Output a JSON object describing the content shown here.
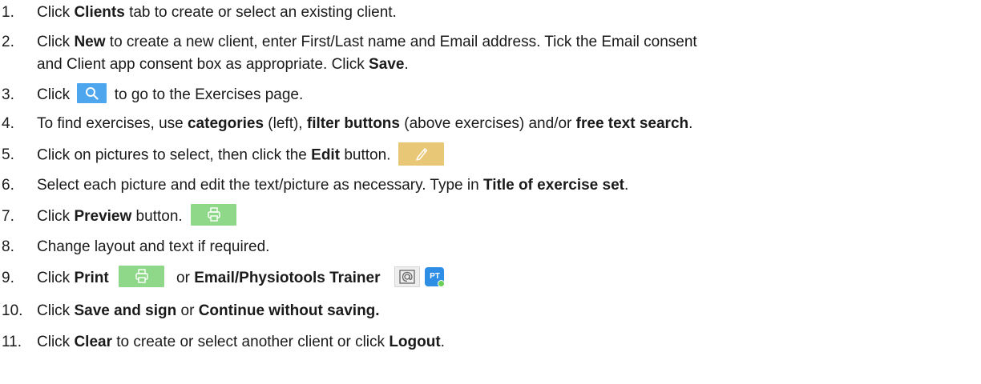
{
  "steps": [
    {
      "number": "1.",
      "p1": "Click ",
      "b1": "Clients",
      "p2": " tab to create or select an existing client."
    },
    {
      "number": "2.",
      "p1": "Click ",
      "b1": "New",
      "p2": " to create a new client, enter First/Last name and Email address. Tick the Email consent",
      "p3": "and Client app consent box as appropriate. Click ",
      "b2": "Save",
      "p4": "."
    },
    {
      "number": "3.",
      "p1": "Click ",
      "p2": " to go to the Exercises page.",
      "icon": "search-icon"
    },
    {
      "number": "4.",
      "p1": "To find exercises, use ",
      "b1": "categories",
      "p2": " (left), ",
      "b2": "filter buttons",
      "p3": " (above exercises) and/or ",
      "b3": "free text search",
      "p4": "."
    },
    {
      "number": "5.",
      "p1": "Click on pictures to select, then click the ",
      "b1": "Edit",
      "p2": " button.",
      "icon": "pencil-icon"
    },
    {
      "number": "6.",
      "p1": "Select each picture and edit the text/picture as necessary.  Type in ",
      "b1": "Title of exercise set",
      "p2": "."
    },
    {
      "number": "7.",
      "p1": "Click ",
      "b1": "Preview",
      "p2": " button.",
      "icon": "printer-icon"
    },
    {
      "number": "8.",
      "p1": "Change layout and text if required."
    },
    {
      "number": "9.",
      "p1": "Click ",
      "b1": "Print",
      "p2": " or ",
      "b2": "Email/Physiotools Trainer",
      "icon": "printer-icon",
      "icon2": "email-icon",
      "icon3": "pt-icon",
      "pt_label": "PT"
    },
    {
      "number": "10.",
      "p1": "Click ",
      "b1": "Save and sign",
      "p2": " or ",
      "b2": "Continue without saving."
    },
    {
      "number": "11.",
      "p1": "Click ",
      "b1": "Clear",
      "p2": " to create or select another client or click ",
      "b2": "Logout",
      "p3": "."
    }
  ],
  "colors": {
    "search_button": "#4da6ee",
    "edit_button": "#e8c877",
    "print_button": "#8fd88a",
    "email_button": "#eeeeee",
    "pt_button": "#2e8ee6"
  }
}
